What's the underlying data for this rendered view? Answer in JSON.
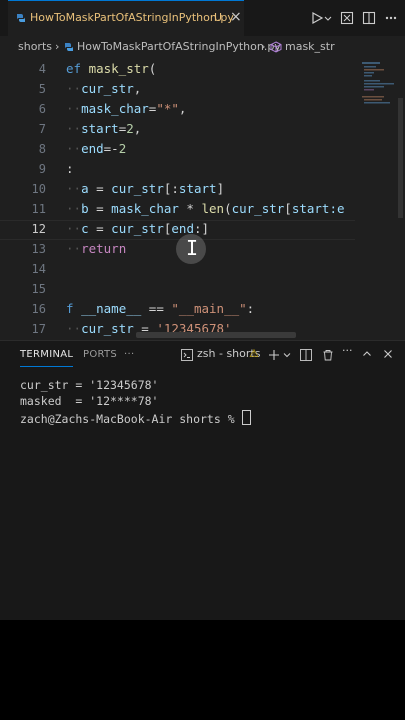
{
  "tab": {
    "filename": "HowToMaskPartOfAStringInPython.py",
    "modified": "U",
    "close": "×"
  },
  "breadcrumb": {
    "folder": "shorts",
    "file": "HowToMaskPartOfAStringInPython.py",
    "symbol": "mask_str",
    "sep": "›"
  },
  "editor": {
    "line_numbers": [
      "4",
      "5",
      "6",
      "7",
      "8",
      "9",
      "10",
      "11",
      "12",
      "13",
      "14",
      "15",
      "16",
      "17"
    ],
    "lines": {
      "l4": {
        "a": "ef ",
        "b": "mask_str",
        "c": "("
      },
      "l5": {
        "a": "··",
        "b": "cur_str",
        "c": ","
      },
      "l6": {
        "a": "··",
        "b": "mask_char",
        "c": "=",
        "d": "\"*\"",
        "e": ","
      },
      "l7": {
        "a": "··",
        "b": "start",
        "c": "=",
        "d": "2",
        "e": ","
      },
      "l8": {
        "a": "··",
        "b": "end",
        "c": "=-",
        "d": "2"
      },
      "l9": {
        "a": ":"
      },
      "l10": {
        "a": "··",
        "b": "a",
        "c": " = ",
        "d": "cur_str",
        "e": "[:",
        "f": "start",
        "g": "]"
      },
      "l11": {
        "a": "··",
        "b": "b",
        "c": " = ",
        "d": "mask_char",
        "e": " * ",
        "f": "len",
        "g": "(",
        "h": "cur_str",
        "i": "[",
        "j": "start",
        "k": ":e"
      },
      "l12": {
        "a": "··",
        "b": "c",
        "c": " = ",
        "d": "cur_str",
        "e": "[",
        "f": "end",
        "g": ":]"
      },
      "l13": {
        "a": "··",
        "b": "return"
      },
      "l16": {
        "a": "f ",
        "b": "__name__",
        "c": " == ",
        "d": "\"__main__\"",
        "e": ":"
      },
      "l17": {
        "a": "··",
        "b": "cur_str",
        "c": " = ",
        "d": "'12345678'"
      }
    }
  },
  "panel": {
    "tabs": [
      "TERMINAL",
      "PORTS"
    ],
    "more": "···",
    "shell_label": "zsh - shorts",
    "warning": "⚠",
    "terminal_lines": [
      "cur_str = '12345678'",
      "masked  = '12****78'",
      "zach@Zachs-MacBook-Air shorts % "
    ]
  },
  "colors": {
    "accent": "#0078d4",
    "modified_tab": "#e8c07a",
    "background": "#1f1f1f"
  }
}
